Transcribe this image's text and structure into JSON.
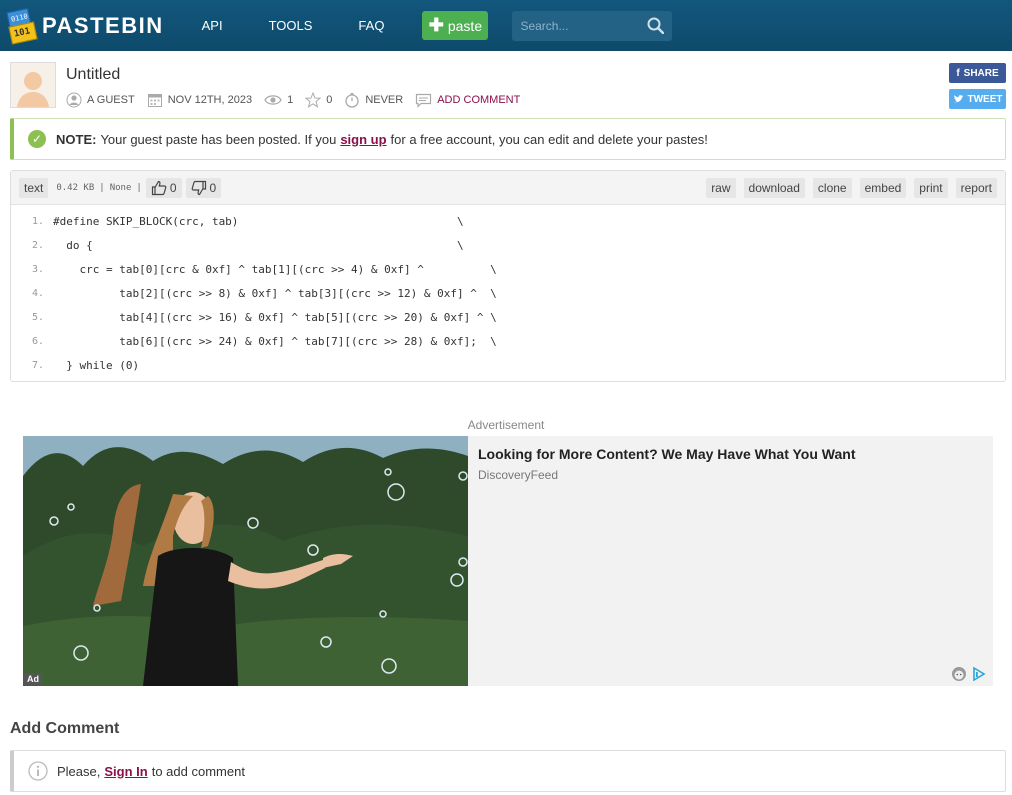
{
  "header": {
    "logo_text": "PASTEBIN",
    "nav": [
      "API",
      "TOOLS",
      "FAQ"
    ],
    "paste_button": "paste",
    "search_placeholder": "Search..."
  },
  "paste": {
    "title": "Untitled",
    "author": "A GUEST",
    "date": "NOV 12TH, 2023",
    "views": "1",
    "stars": "0",
    "expiry": "NEVER",
    "add_comment": "ADD COMMENT"
  },
  "share": {
    "facebook": "SHARE",
    "twitter": "TWEET"
  },
  "notice": {
    "label": "NOTE:",
    "text_before": "Your guest paste has been posted. If you",
    "link": "sign up",
    "text_after": "for a free account, you can edit and delete your pastes!"
  },
  "code_bar": {
    "syntax": "text",
    "size": "0.42 KB",
    "category": "None",
    "likes": "0",
    "dislikes": "0",
    "actions": [
      "raw",
      "download",
      "clone",
      "embed",
      "print",
      "report"
    ]
  },
  "code_lines": [
    {
      "n": "1.",
      "code": "#define SKIP_BLOCK(crc, tab)                                 \\"
    },
    {
      "n": "2.",
      "code": "  do {                                                       \\"
    },
    {
      "n": "3.",
      "code": "    crc = tab[0][crc & 0xf] ^ tab[1][(crc >> 4) & 0xf] ^          \\"
    },
    {
      "n": "4.",
      "code": "          tab[2][(crc >> 8) & 0xf] ^ tab[3][(crc >> 12) & 0xf] ^  \\"
    },
    {
      "n": "5.",
      "code": "          tab[4][(crc >> 16) & 0xf] ^ tab[5][(crc >> 20) & 0xf] ^ \\"
    },
    {
      "n": "6.",
      "code": "          tab[6][(crc >> 24) & 0xf] ^ tab[7][(crc >> 28) & 0xf];  \\"
    },
    {
      "n": "7.",
      "code": "  } while (0)"
    }
  ],
  "ad": {
    "label": "Advertisement",
    "badge": "Ad",
    "headline": "Looking for More Content? We May Have What You Want",
    "source": "DiscoveryFeed"
  },
  "comments": {
    "title": "Add Comment",
    "text_before": "Please,",
    "link": "Sign In",
    "text_after": "to add comment"
  },
  "colors": {
    "header_bg": "#12577d",
    "paste_green": "#4caf50",
    "link_maroon": "#8c0e4a",
    "notice_green": "#8cc152"
  }
}
